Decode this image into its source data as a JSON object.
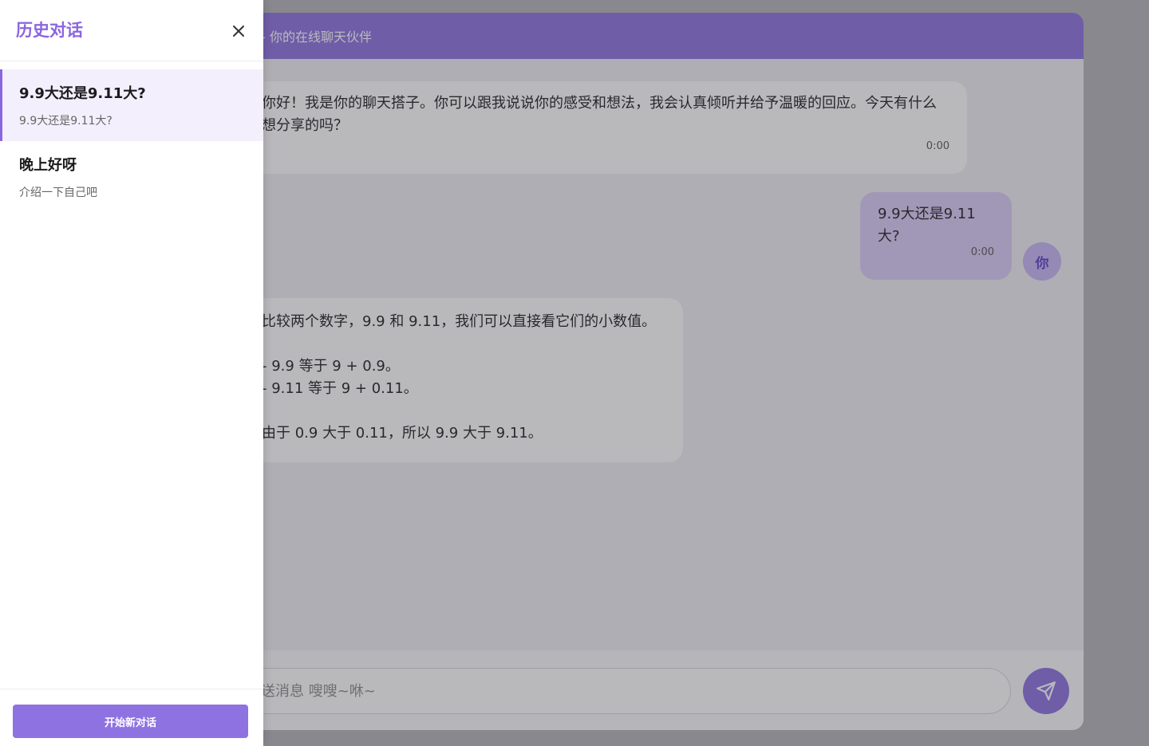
{
  "chat": {
    "header_title": "e – 你的在线聊天伙伴",
    "messages": [
      {
        "role": "bot",
        "text": "你好！我是你的聊天搭子。你可以跟我说说你的感受和想法，我会认真倾听并给予温暖的回应。今天有什么想分享的吗？",
        "time": "0:00"
      },
      {
        "role": "user",
        "text": "9.9大还是9.11大?",
        "time": "0:00"
      },
      {
        "role": "bot",
        "text": "比较两个数字，9.9 和 9.11，我们可以直接看它们的小数值。\n\n- 9.9 等于 9 + 0.9。\n- 9.11 等于 9 + 0.11。\n\n由于 0.9 大于 0.11，所以 9.9 大于 9.11。"
      }
    ],
    "user_avatar_label": "你",
    "input_placeholder": "送消息 嗖嗖~咻~"
  },
  "drawer": {
    "title": "历史对话",
    "close_icon": "close-icon",
    "items": [
      {
        "title": "9.9大还是9.11大?",
        "preview": "9.9大还是9.11大?",
        "active": true
      },
      {
        "title": "晚上好呀",
        "preview": "介绍一下自己吧",
        "active": false
      }
    ],
    "new_chat_label": "开始新对话"
  },
  "colors": {
    "accent": "#8b6fe0",
    "user_bubble": "#d9ccf8",
    "drawer_active_bg": "#f3effd"
  }
}
